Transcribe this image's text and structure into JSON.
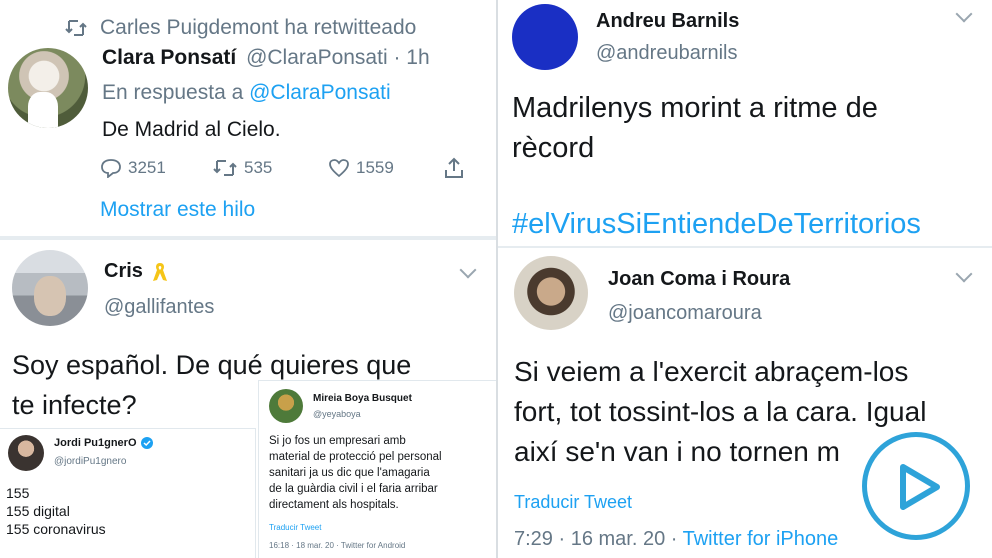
{
  "top_left": {
    "retweet_note": "Carles Puigdemont ha retwitteado",
    "author_name": "Clara Ponsatí",
    "handle_time": "@ClaraPonsati · 1h",
    "reply_prefix": "En respuesta a",
    "reply_handle": "@ClaraPonsati",
    "text": "De Madrid al Cielo.",
    "replies": "3251",
    "retweets": "535",
    "likes": "1559",
    "show_thread": "Mostrar este hilo"
  },
  "top_right": {
    "author_name": "Andreu Barnils",
    "handle": "@andreubarnils",
    "text_line1": "Madrilenys morint a ritme de",
    "text_line2": "rècord",
    "hashtag": "#elVirusSiEntiendeDeTerritorios"
  },
  "bottom_left": {
    "author_name": "Cris",
    "handle": "@gallifantes",
    "text_line1": "Soy español. De qué quieres que",
    "text_line2": "te infecte?",
    "embed_a": {
      "author_name": "Jordi Pu1gnerO",
      "handle": "@jordiPu1gnero",
      "lines": [
        "155",
        "155 digital",
        "155 coronavirus"
      ]
    },
    "embed_b": {
      "author_name": "Mireia Boya Busquet",
      "handle": "@yeyaboya",
      "lines": [
        "Si jo fos un empresari amb",
        "material de protecció pel personal",
        "sanitari ja us dic que l'amagaria",
        "de la guàrdia civil i el faria arribar",
        "directament als hospitals."
      ],
      "translate": "Traducir Tweet",
      "meta": "16:18 · 18 mar. 20 · Twitter for Android"
    }
  },
  "bottom_right": {
    "author_name": "Joan Coma i Roura",
    "handle": "@joancomaroura",
    "text_line1": "Si veiem a l'exercit abraçem-los",
    "text_line2": "fort, tot tossint-los a la cara. Igual",
    "text_line3": "així se'n van i no tornen m",
    "translate": "Traducir Tweet",
    "meta_time": "7:29 · 16 mar. 20 ·",
    "meta_client": "Twitter for iPhone"
  },
  "colors": {
    "accent": "#1da1f2",
    "muted": "#657786",
    "play_ring": "#2ea3d9",
    "ribbon": "#f5c518"
  },
  "icons": [
    "retweet-icon",
    "reply-icon",
    "like-icon",
    "share-icon",
    "chevron-down-icon",
    "yellow-ribbon-icon",
    "verified-icon",
    "play-icon"
  ]
}
